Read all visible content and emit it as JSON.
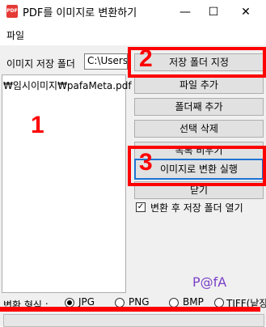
{
  "window": {
    "title": "PDF를 이미지로 변환하기",
    "icon_text": "PDF",
    "minimize_glyph": "—",
    "maximize_glyph": "☐",
    "close_glyph": "✕"
  },
  "menu": {
    "file": "파일"
  },
  "save_folder": {
    "label": "이미지 저장 폴더",
    "value": "C:\\Users"
  },
  "file_list": {
    "items": [
      "₩임시이미지₩pafaMeta.pdf"
    ]
  },
  "buttons": {
    "set_folder": "저장 폴더 지정",
    "add_file": "파일 추가",
    "add_folder": "폴더째 추가",
    "delete_selected": "선택 삭제",
    "delete_all": "목록 비우기",
    "convert": "이미지로 변환 실행",
    "close": "닫기"
  },
  "open_after": {
    "checked": true,
    "label": "변환 후 저장 폴더 열기",
    "check_glyph": "✓"
  },
  "logo": "P@fA",
  "format": {
    "label": "변환 형식 :",
    "options": [
      "JPG",
      "PNG",
      "BMP",
      "TIFF(낱장)"
    ],
    "selected": "JPG"
  },
  "annotations": {
    "n1": "1",
    "n2": "2",
    "n3": "3",
    "color": "#ff0000"
  }
}
